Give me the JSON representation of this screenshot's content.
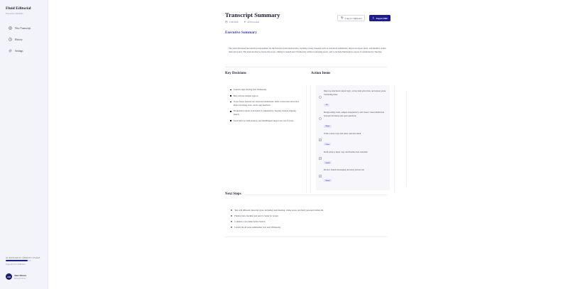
{
  "sidebar": {
    "brand": "Fluid Editorial",
    "brand_sub": "Executive Analysis",
    "items": [
      {
        "label": "New Transcript",
        "icon": "plus-circle-icon"
      },
      {
        "label": "History",
        "icon": "clock-icon"
      },
      {
        "label": "Settings",
        "icon": "gear-icon"
      }
    ],
    "usage": {
      "label": "AI RESEARCH CREDITS USAGE",
      "fill": 0.85,
      "link": "Upgrade for Unlimited"
    },
    "user": {
      "initials": "AR",
      "name": "Alex Rivera",
      "plan": "Managed Plan"
    }
  },
  "header": {
    "title": "Transcript Summary",
    "date": "1/29/2026",
    "source": "AI Processed",
    "copy_label": "Copy to Clipboard",
    "export_label": "Export PDF"
  },
  "executive_summary": {
    "heading": "Executive Summary",
    "text": "The team discussed the launch postponement for the AI notes transcription beta, focusing on key features such as structured summaries, improved export sizes, and intuitive action item extraction. The team decided to freeze the scope, aiming to launch next Wednesday without replaying topics, and to include Marketplace export if completed by Tuesday."
  },
  "key_decisions": {
    "heading": "Key Decisions",
    "items": [
      "Launch target moving next Wednesday",
      "Beta will use tempter sign-in",
      "Scope freeze features are structured summaries, better action item extraction, improved empty state, and in-app feedback",
      "Marketplace export is included if completed by Tuesday without slipping launch",
      "Saved history, team features, and multilingual support are out of scope"
    ]
  },
  "action_items": {
    "heading": "Action Items",
    "items": [
      {
        "text": "Improve structured output logic, action item extraction, and ensure parse formatting issue",
        "owner": "Ali"
      },
      {
        "text": "Design empty state, sample transparency, and clearer visual distinction between decisions and open questions",
        "owner": "Maya"
      },
      {
        "text": "Write rollout copy and tester onboard email",
        "owner": "Chen"
      },
      {
        "text": "Draft privacy input copy and finalize beta checklist",
        "owner": "Sarah"
      },
      {
        "text": "Review launch messaging and entry private list",
        "owner": "Marie"
      }
    ]
  },
  "next_steps": {
    "heading": "Next Steps",
    "items": [
      "Test with different transcript types, including team meeting, strider notes, and fairly personal brainstorm",
      "Finalize beta checklist and send to Sarah for review",
      "Complete a pre-demo before launch",
      "Launch the AI notes summarizer beta next Wednesday"
    ]
  }
}
